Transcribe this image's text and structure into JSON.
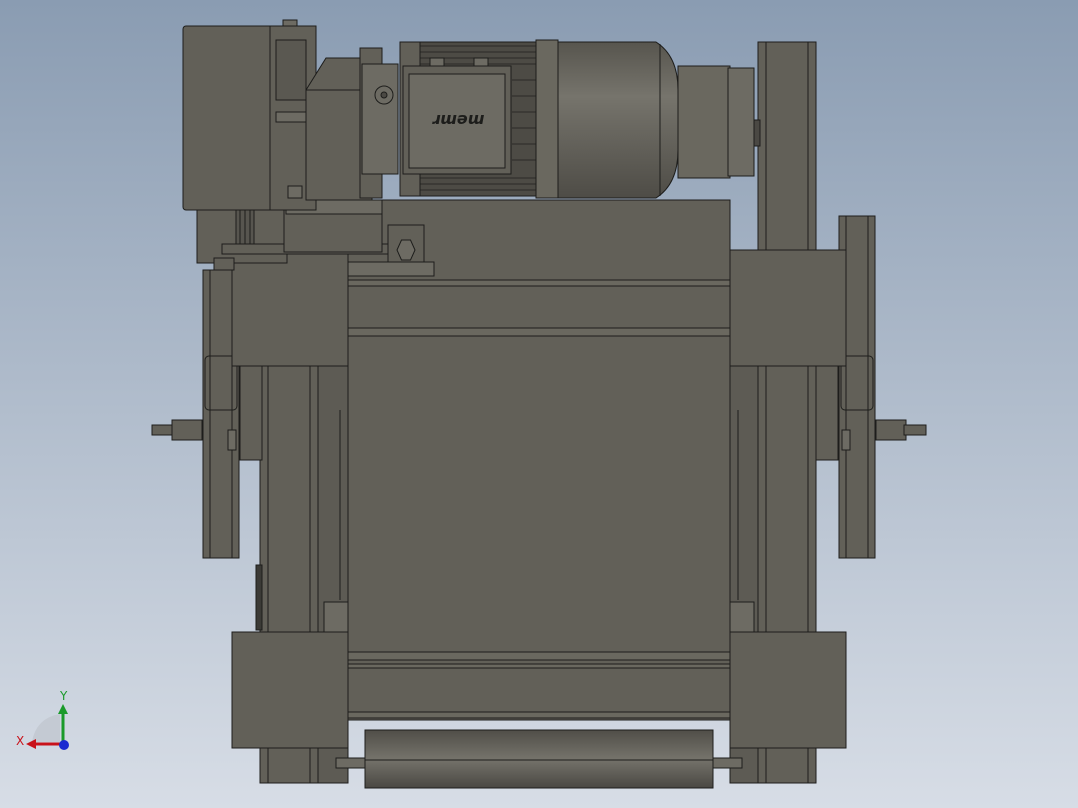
{
  "motor": {
    "brand_label": "ɹɯəɯ"
  },
  "triad": {
    "x_label": "X",
    "y_label": "Y"
  },
  "colors": {
    "background_top": "#8a9cb2",
    "background_bottom": "#d7dde6",
    "part_fill": "#626058",
    "part_fill_light": "#6d6b63",
    "part_edge": "#1d1d1b",
    "x_axis": "#c8121a",
    "y_axis": "#1a9a2a",
    "z_axis": "#1a2ad0"
  }
}
